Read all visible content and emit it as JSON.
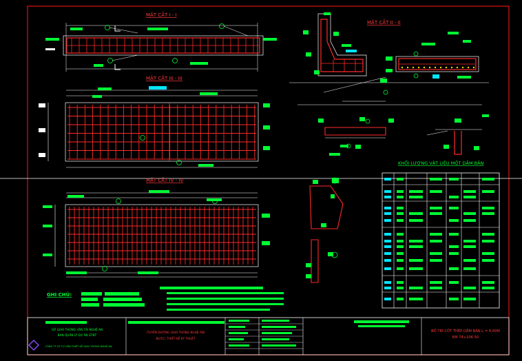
{
  "colors": {
    "background": "#000000",
    "frame": "#e01010",
    "rebar": "#ff2a2a",
    "dimension": "#ffffff",
    "label": "#00ff33",
    "tag": "#00e5ff",
    "title_text": "#ff3b3b"
  },
  "drawing": {
    "section_1_title": "MẶT CẮT I - I",
    "section_2_title": "MẶT CẮT II - II",
    "section_3_title": "MẶT CẮT III - III",
    "section_4_title": "MẶT CẮT IV - IV",
    "quantity_table_title": "KHỐI LƯỢNG VẬT LIỆU MỘT DẦM BẢN",
    "notes_label": "GHI CHÚ:",
    "marker_a": "5",
    "marker_b": "6",
    "marker_c": "8",
    "marker_d": "10",
    "marker_e": "11",
    "row_labels": [
      "6",
      "3",
      "4",
      "5",
      "6",
      "8",
      "12",
      "13",
      "14",
      "15",
      "16"
    ]
  },
  "title_block": {
    "org_line_1": "SỞ GIAO THÔNG VẬN TẢI NGHỆ AN",
    "org_line_2": "BAN QUẢN LÝ DỰ ÁN GTNT",
    "org_line_3": "CÔNG TY CP TƯ VẤN THIẾT KẾ GIAO THÔNG NGHỆ AN",
    "project_line_1": "(TUYẾN ĐƯỜNG GIAO THÔNG NGHỆ AN)",
    "stage": "BƯỚC: THIẾT KẾ KỸ THUẬT",
    "drawing_title": "BỐ TRÍ CỐT THÉP DẦM BẢN L = 6.00M",
    "chainage": "KM 74+206.50"
  }
}
